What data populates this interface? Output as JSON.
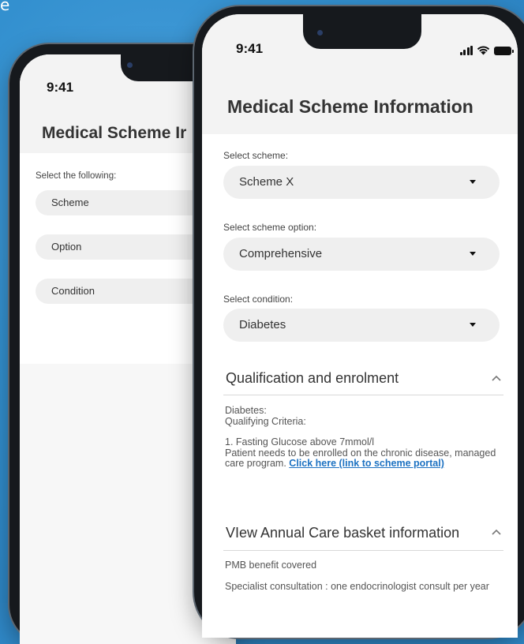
{
  "corner_text": "e",
  "back_phone": {
    "time": "9:41",
    "title": "Medical Scheme Ir",
    "select_label": "Select the following:",
    "fields": [
      "Scheme",
      "Option",
      "Condition"
    ]
  },
  "front_phone": {
    "time": "9:41",
    "title": "Medical Scheme Information",
    "scheme": {
      "label": "Select scheme:",
      "value": "Scheme X"
    },
    "option": {
      "label": "Select scheme option:",
      "value": "Comprehensive"
    },
    "condition": {
      "label": "Select condition:",
      "value": "Diabetes"
    },
    "qualification": {
      "title": "Qualification and enrolment",
      "line1": "Diabetes:",
      "line2": "Qualifying Criteria:",
      "criteria": "1. Fasting Glucose above 7mmol/l",
      "enrol_text": "Patient needs to be enrolled on the chronic disease, managed care  program.",
      "link_text": "Click here (link to scheme portal)"
    },
    "care_basket": {
      "title": "VIew Annual Care basket information",
      "line1": "PMB benefit covered",
      "line2": "Specialist consultation : one endocrinologist consult per year"
    }
  },
  "colors": {
    "background": "#2f87c6",
    "link": "#1d72c2"
  }
}
